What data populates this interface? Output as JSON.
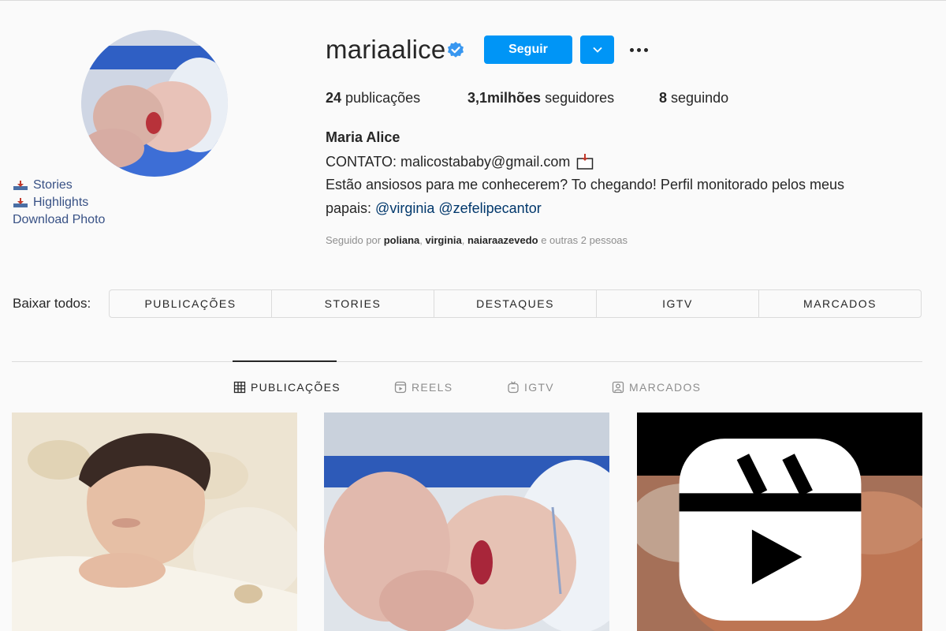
{
  "profile": {
    "username": "mariaalice",
    "full_name": "Maria Alice",
    "verified_icon": "verified-badge-icon",
    "follow_label": "Seguir",
    "stats": {
      "posts_count": "24",
      "posts_label": "publicações",
      "followers_count": "3,1milhões",
      "followers_label": "seguidores",
      "following_count": "8",
      "following_label": "seguindo"
    },
    "bio": {
      "contact": "CONTATO: malicostababy@gmail.com",
      "line2": "Estão ansiosos para me conhecerem? To chegando! Perfil monitorado pelos meus",
      "line3_prefix": "papais: ",
      "mention1": "@virginia",
      "mention2": "@zefelipecantor"
    },
    "followed_by": {
      "prefix": "Seguido por ",
      "user1": "poliana",
      "user2": "virginia",
      "user3": "naiaraazevedo",
      "suffix": " e outras 2 pessoas"
    }
  },
  "downloader": {
    "stories": "Stories",
    "highlights": "Highlights",
    "photo": "Download Photo",
    "all_label": "Baixar todos:",
    "tabs": [
      "PUBLICAÇÕES",
      "STORIES",
      "DESTAQUES",
      "IGTV",
      "MARCADOS"
    ]
  },
  "profile_tabs": {
    "posts": "PUBLICAÇÕES",
    "reels": "REELS",
    "igtv": "IGTV",
    "tagged": "MARCADOS",
    "active": "posts"
  },
  "colors": {
    "accent": "#0095f6",
    "link": "#385185",
    "mention": "#00376b",
    "background": "#fafafa",
    "border": "#dbdbdb"
  }
}
